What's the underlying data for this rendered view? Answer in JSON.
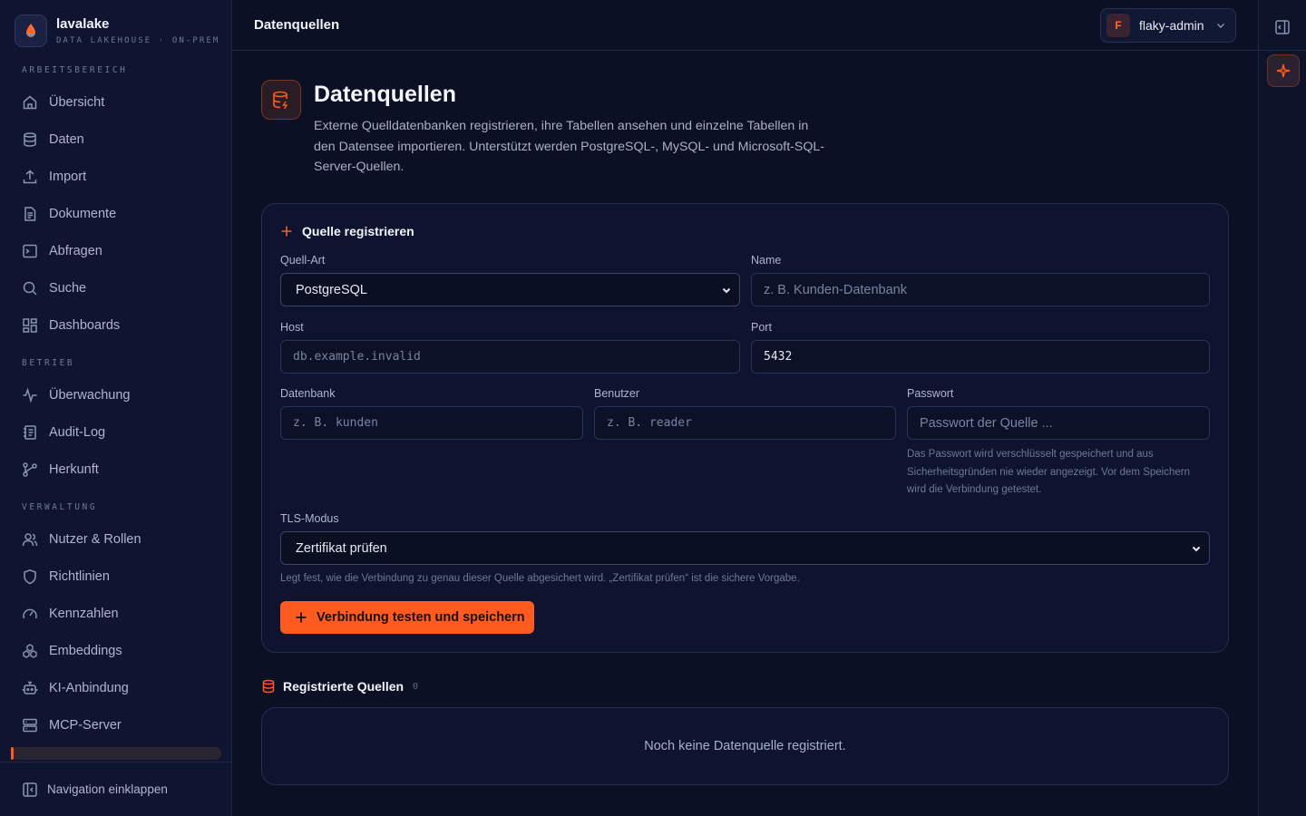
{
  "brand": {
    "name": "lavalake",
    "subtitle": "DATA LAKEHOUSE · ON-PREM"
  },
  "sidebar": {
    "sections": [
      {
        "label": "ARBEITSBEREICH",
        "items": [
          {
            "label": "Übersicht",
            "icon": "home-icon"
          },
          {
            "label": "Daten",
            "icon": "database-icon"
          },
          {
            "label": "Import",
            "icon": "upload-icon"
          },
          {
            "label": "Dokumente",
            "icon": "document-icon"
          },
          {
            "label": "Abfragen",
            "icon": "terminal-icon"
          },
          {
            "label": "Suche",
            "icon": "search-icon"
          },
          {
            "label": "Dashboards",
            "icon": "dashboard-icon"
          }
        ]
      },
      {
        "label": "BETRIEB",
        "items": [
          {
            "label": "Überwachung",
            "icon": "activity-icon"
          },
          {
            "label": "Audit-Log",
            "icon": "log-icon"
          },
          {
            "label": "Herkunft",
            "icon": "lineage-icon"
          }
        ]
      },
      {
        "label": "VERWALTUNG",
        "items": [
          {
            "label": "Nutzer & Rollen",
            "icon": "users-icon"
          },
          {
            "label": "Richtlinien",
            "icon": "shield-icon"
          },
          {
            "label": "Kennzahlen",
            "icon": "gauge-icon"
          },
          {
            "label": "Embeddings",
            "icon": "embeddings-icon"
          },
          {
            "label": "KI-Anbindung",
            "icon": "bot-icon"
          },
          {
            "label": "MCP-Server",
            "icon": "server-icon"
          }
        ]
      }
    ],
    "footer_label": "Navigation einklappen"
  },
  "topbar": {
    "title": "Datenquellen",
    "user": {
      "initial": "F",
      "name": "flaky-admin"
    }
  },
  "page": {
    "title": "Datenquellen",
    "description": "Externe Quelldatenbanken registrieren, ihre Tabellen ansehen und einzelne Tabellen in den Datensee importieren. Unterstützt werden PostgreSQL-, MySQL- und Microsoft-SQL-Server-Quellen."
  },
  "form": {
    "heading": "Quelle registrieren",
    "source_type": {
      "label": "Quell-Art",
      "value": "PostgreSQL"
    },
    "name": {
      "label": "Name",
      "placeholder": "z. B. Kunden-Datenbank"
    },
    "host": {
      "label": "Host",
      "placeholder": "db.example.invalid"
    },
    "port": {
      "label": "Port",
      "value": "5432"
    },
    "database": {
      "label": "Datenbank",
      "placeholder": "z. B. kunden"
    },
    "user": {
      "label": "Benutzer",
      "placeholder": "z. B. reader"
    },
    "password": {
      "label": "Passwort",
      "placeholder": "Passwort der Quelle ...",
      "hint": "Das Passwort wird verschlüsselt gespeichert und aus Sicherheitsgründen nie wieder angezeigt. Vor dem Speichern wird die Verbindung getestet."
    },
    "tls": {
      "label": "TLS-Modus",
      "value": "Zertifikat prüfen",
      "hint": "Legt fest, wie die Verbindung zu genau dieser Quelle abgesichert wird. „Zertifikat prüfen“ ist die sichere Vorgabe."
    },
    "submit_label": "Verbindung testen und speichern"
  },
  "sources": {
    "heading": "Registrierte Quellen",
    "count": "0",
    "empty_text": "Noch keine Datenquelle registriert."
  },
  "colors": {
    "accent": "#ff5a1f",
    "background": "#0b1024",
    "sidebar": "#0f1530"
  }
}
